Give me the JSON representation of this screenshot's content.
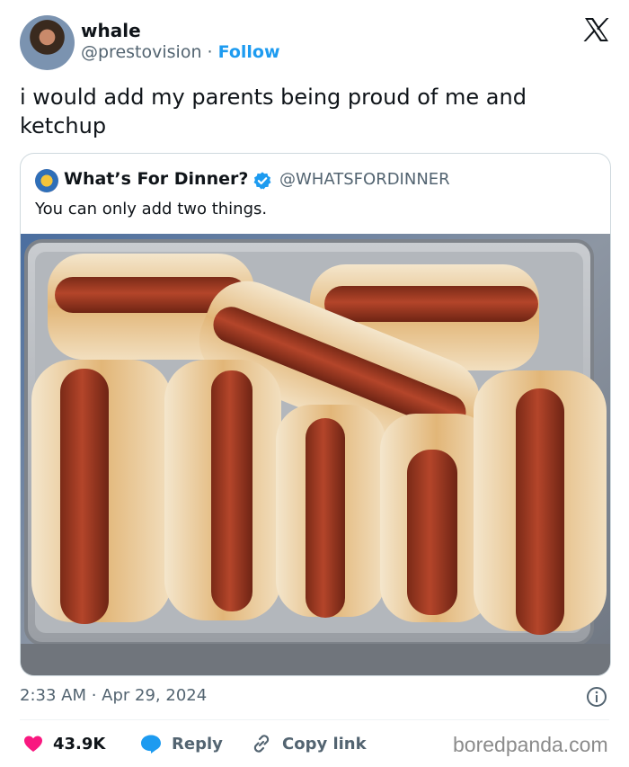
{
  "author": {
    "name": "whale",
    "handle": "@prestovision",
    "separator": "·",
    "follow_label": "Follow"
  },
  "platform_logo": "x-logo-icon",
  "tweet": {
    "text": "i would add my parents being proud of me and ketchup"
  },
  "quoted_tweet": {
    "name": "What’s For Dinner?",
    "verified": true,
    "handle": "@WHATSFORDINNER",
    "text": "You can only add two things.",
    "image_subject": "hot-dogs-on-tray"
  },
  "timestamp": "2:33 AM · Apr 29, 2024",
  "actions": {
    "likes": "43.9K",
    "reply_label": "Reply",
    "copy_link_label": "Copy link"
  },
  "watermark": "boredpanda.com",
  "colors": {
    "accent": "#1d9bf0",
    "like": "#f91880",
    "muted": "#536471",
    "text": "#0f1419",
    "border": "#cfd9de"
  }
}
